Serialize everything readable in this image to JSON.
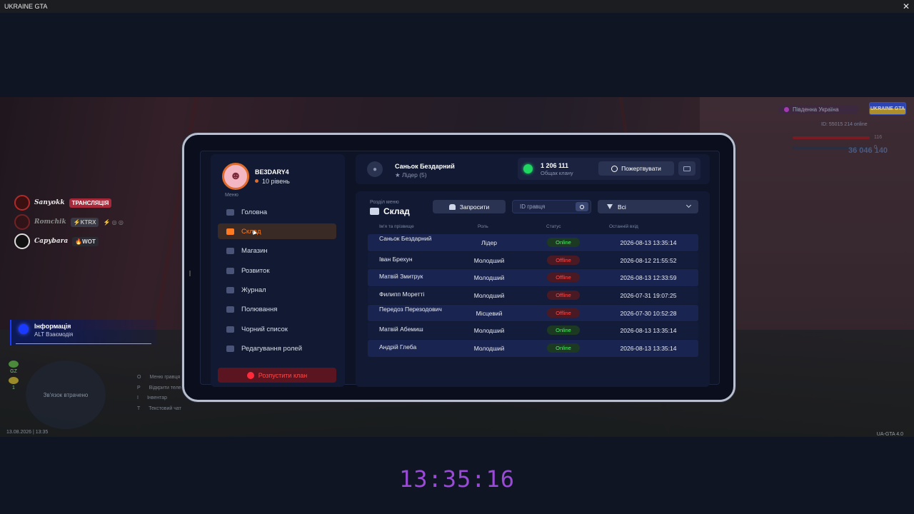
{
  "window": {
    "title": "UKRAINE GTA"
  },
  "clock": "13:35:16",
  "hud": {
    "voice_chat": [
      {
        "name": "Sanyokk",
        "badge": "ТРАНСЛЯЦІЯ",
        "extra": ""
      },
      {
        "name": "Romchik",
        "badge": "⚡KTRX",
        "extra": "⚡ ◎ ◎"
      },
      {
        "name": "Capybara",
        "badge": "🔥WOT",
        "extra": ""
      }
    ],
    "info": {
      "title": "Інформація",
      "hint": "ALT Взаємодія"
    },
    "gz": "GZ",
    "gz_count": "1",
    "minimap_text": "Зв'язок втрачено",
    "keys": [
      {
        "key": "O",
        "label": "Меню гравця"
      },
      {
        "key": "P",
        "label": "Відкрити телефон"
      },
      {
        "key": "I",
        "label": "Інвентар"
      },
      {
        "key": "T",
        "label": "Текстовий чат"
      }
    ],
    "datestamp": "13.08.2026 | 13:35",
    "version": "UA-GTA 4.0",
    "region": "Південна Україна",
    "logo": "UKRAINE GTA",
    "id_line": "ID: 55015   214 online",
    "bars": {
      "health": "116",
      "armor": "0"
    },
    "money": "36 046 140"
  },
  "profile": {
    "name": "BE3DARY4",
    "level": "10 рівень"
  },
  "menu": {
    "caption": "Меню",
    "items": [
      {
        "label": "Головна"
      },
      {
        "label": "Склад"
      },
      {
        "label": "Магазин"
      },
      {
        "label": "Розвиток"
      },
      {
        "label": "Журнал"
      },
      {
        "label": "Полювання"
      },
      {
        "label": "Чорний список"
      },
      {
        "label": "Редагування ролей"
      }
    ],
    "active": "Склад",
    "disband_label": "Розпустити клан"
  },
  "header": {
    "user_name": "Саньок Бездарний",
    "user_role": "★ Лідер (5)",
    "balance_amount": "1 206 111",
    "balance_label": "Общак клану",
    "donate_label": "Пожертвувати"
  },
  "section": {
    "caption": "Розділ меню",
    "title": "Склад",
    "invite_label": "Запросити",
    "search_placeholder": "ID гравця",
    "filter_value": "Всі"
  },
  "table": {
    "columns": [
      "Ім'я та прізвище",
      "Роль",
      "Статус",
      "Останній вхід"
    ],
    "rows": [
      {
        "name": "Саньок Бездарний",
        "role": "Лідер",
        "status": "Online",
        "last": "2026-08-13 13:35:14"
      },
      {
        "name": "Іван Брехун",
        "role": "Молодший",
        "status": "Offline",
        "last": "2026-08-12 21:55:52"
      },
      {
        "name": "Матвій Змитрук",
        "role": "Молодший",
        "status": "Offline",
        "last": "2026-08-13 12:33:59"
      },
      {
        "name": "Филипп Моретті",
        "role": "Молодший",
        "status": "Offline",
        "last": "2026-07-31 19:07:25"
      },
      {
        "name": "Передоз Перезодович",
        "role": "Місцевий",
        "status": "Offline",
        "last": "2026-07-30 10:52:28"
      },
      {
        "name": "Матвій Абемиш",
        "role": "Молодший",
        "status": "Online",
        "last": "2026-08-13 13:35:14"
      },
      {
        "name": "Андрій Глеба",
        "role": "Молодший",
        "status": "Online",
        "last": "2026-08-13 13:35:14"
      }
    ]
  },
  "colors": {
    "accent": "#ff7a20",
    "online": "#4ef06a",
    "offline": "#ff4a4a",
    "clock": "#9a4ad6"
  }
}
